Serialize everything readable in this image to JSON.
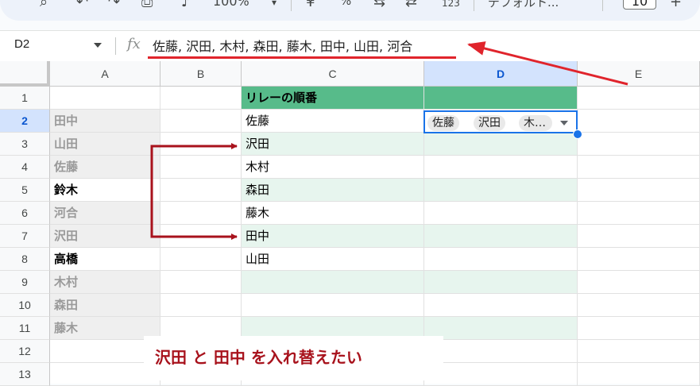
{
  "toolbar": {
    "zoom": "100%",
    "percent": "%",
    "format_123": "123",
    "font_name": "デフォルト...",
    "font_size": "10",
    "plus": "+"
  },
  "formula_bar": {
    "cell_ref": "D2",
    "fx": "fx",
    "formula": "佐藤, 沢田, 木村, 森田, 藤木, 田中, 山田, 河合"
  },
  "columns": [
    "A",
    "B",
    "C",
    "D",
    "E"
  ],
  "rows": [
    "1",
    "2",
    "3",
    "4",
    "5",
    "6",
    "7",
    "8",
    "9",
    "10",
    "11",
    "12",
    "13"
  ],
  "col_a": [
    "",
    "田中",
    "山田",
    "佐藤",
    "鈴木",
    "河合",
    "沢田",
    "高橋",
    "木村",
    "森田",
    "藤木",
    "",
    ""
  ],
  "col_c": [
    "リレーの順番",
    "佐藤",
    "沢田",
    "木村",
    "森田",
    "藤木",
    "田中",
    "山田",
    "",
    "",
    "",
    "",
    ""
  ],
  "d2_chips": [
    "佐藤",
    "沢田",
    "木…"
  ],
  "annotation": "沢田 と 田中 を入れ替えたい",
  "colors": {
    "accent_red": "#e0242c",
    "dark_red": "#a8121c",
    "header_green": "#57bb8a",
    "light_green": "#e7f5ee",
    "selection_blue": "#1a73e8"
  }
}
